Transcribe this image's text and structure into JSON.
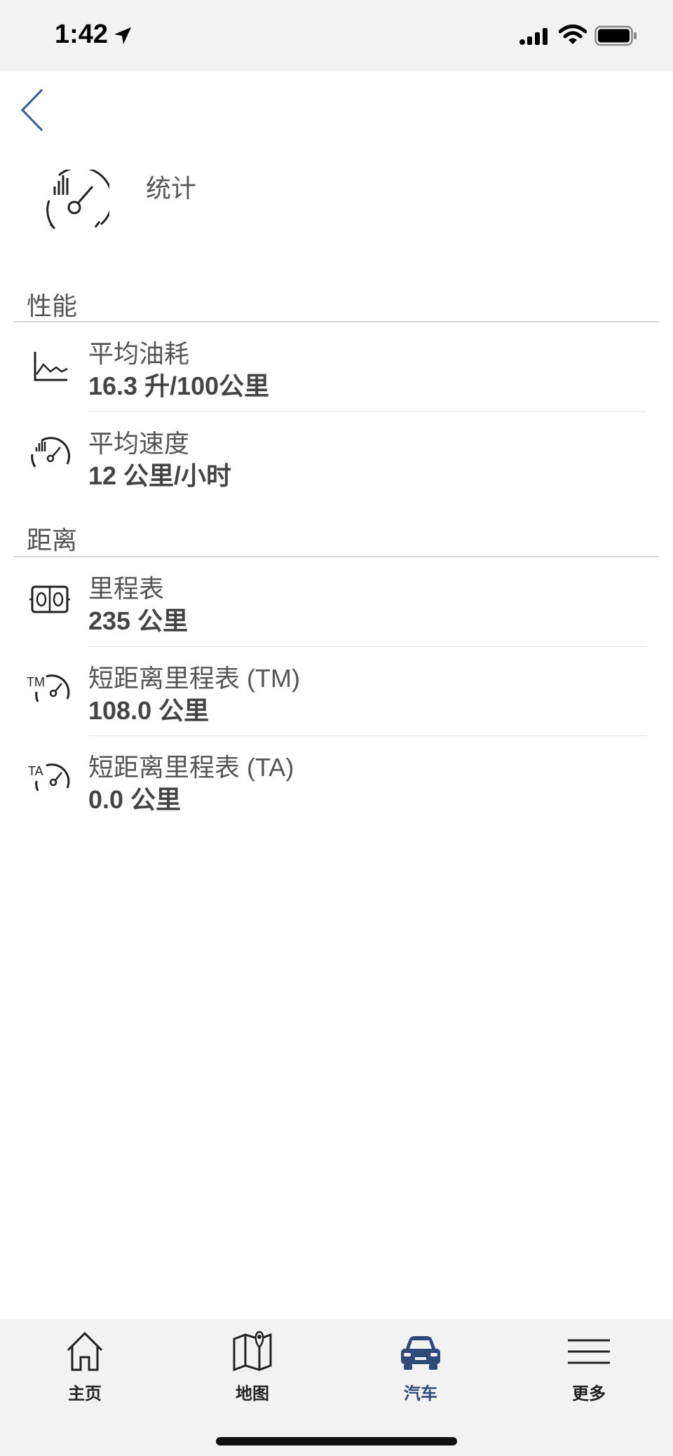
{
  "status_bar": {
    "time": "1:42"
  },
  "header": {
    "title": "统计"
  },
  "sections": [
    {
      "title": "性能",
      "items": [
        {
          "label": "平均油耗",
          "value": "16.3 升/100公里",
          "icon": "fuel-consumption-chart-icon"
        },
        {
          "label": "平均速度",
          "value": "12 公里/小时",
          "icon": "speedometer-icon"
        }
      ]
    },
    {
      "title": "距离",
      "items": [
        {
          "label": "里程表",
          "value": "235 公里",
          "icon": "odometer-icon"
        },
        {
          "label": "短距离里程表 (TM)",
          "value": "108.0 公里",
          "icon": "trip-meter-tm-icon"
        },
        {
          "label": "短距离里程表 (TA)",
          "value": "0.0 公里",
          "icon": "trip-meter-ta-icon"
        }
      ]
    }
  ],
  "tab_bar": {
    "tabs": [
      {
        "label": "主页",
        "icon": "home-icon"
      },
      {
        "label": "地图",
        "icon": "map-icon"
      },
      {
        "label": "汽车",
        "icon": "car-icon",
        "active": true
      },
      {
        "label": "更多",
        "icon": "menu-icon"
      }
    ]
  },
  "colors": {
    "accent": "#2e4a78",
    "back_arrow": "#2e5c9a",
    "divider": "#d6d6d6"
  }
}
